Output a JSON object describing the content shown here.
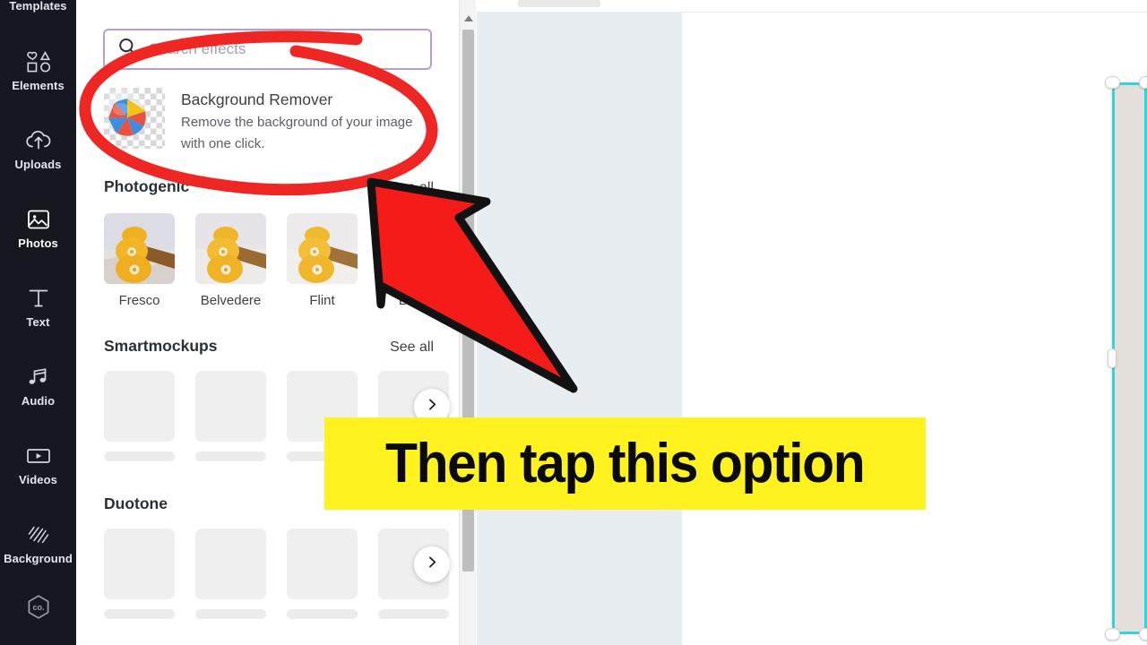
{
  "app": {
    "accent_purple": "#b49fd4",
    "sidebar_bg": "#16181f",
    "annotation_red": "#ee2624",
    "callout_yellow": "#fff21f",
    "selection_cyan": "#2fd8d8"
  },
  "sidebar": {
    "items": [
      {
        "label": "Templates",
        "icon": "templates-icon",
        "active": false
      },
      {
        "label": "Elements",
        "icon": "elements-icon",
        "active": false
      },
      {
        "label": "Uploads",
        "icon": "uploads-icon",
        "active": false
      },
      {
        "label": "Photos",
        "icon": "photos-icon",
        "active": true
      },
      {
        "label": "Text",
        "icon": "text-icon",
        "active": false
      },
      {
        "label": "Audio",
        "icon": "audio-icon",
        "active": false
      },
      {
        "label": "Videos",
        "icon": "videos-icon",
        "active": false
      },
      {
        "label": "Background",
        "icon": "background-icon",
        "active": false
      },
      {
        "label": "",
        "icon": "brand-hex-icon",
        "active": false
      }
    ]
  },
  "search": {
    "placeholder": "Search effects",
    "value": "",
    "icon": "search-icon"
  },
  "background_remover": {
    "title": "Background Remover",
    "description": "Remove the background of your image with one click.",
    "thumb_icon": "beach-ball-transparency-icon"
  },
  "sections": [
    {
      "title": "Photogenic",
      "see_all": "See all",
      "items": [
        {
          "name": "Fresco"
        },
        {
          "name": "Belvedere"
        },
        {
          "name": "Flint"
        },
        {
          "name": "Luna"
        }
      ]
    },
    {
      "title": "Smartmockups",
      "see_all": "See all",
      "items": [
        {
          "name": ""
        },
        {
          "name": ""
        },
        {
          "name": ""
        },
        {
          "name": ""
        }
      ]
    },
    {
      "title": "Duotone",
      "see_all": "",
      "items": [
        {
          "name": ""
        },
        {
          "name": ""
        },
        {
          "name": ""
        },
        {
          "name": ""
        }
      ]
    }
  ],
  "annotations": {
    "callout_text": "Then tap this option",
    "ellipse_target": "background-remover-row",
    "arrow_direction": "up-left"
  }
}
